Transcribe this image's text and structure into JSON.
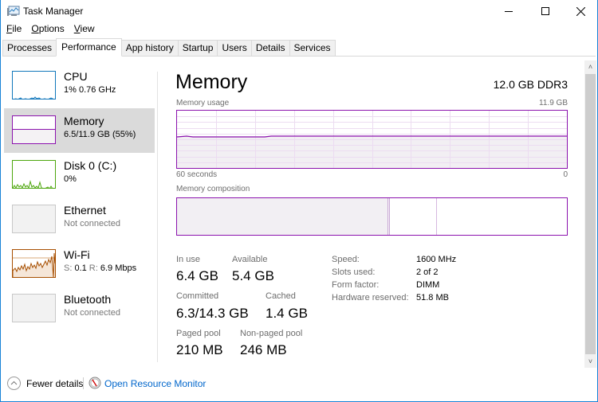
{
  "window": {
    "title": "Task Manager",
    "controls": {
      "minimize": "minimize-icon",
      "maximize": "maximize-icon",
      "close": "close-icon"
    }
  },
  "menu": [
    {
      "label": "File",
      "accel": "F",
      "rest": "ile"
    },
    {
      "label": "Options",
      "accel": "O",
      "rest": "ptions"
    },
    {
      "label": "View",
      "accel": "V",
      "rest": "iew"
    }
  ],
  "tabs": [
    {
      "label": "Processes",
      "active": false
    },
    {
      "label": "Performance",
      "active": true
    },
    {
      "label": "App history",
      "active": false
    },
    {
      "label": "Startup",
      "active": false
    },
    {
      "label": "Users",
      "active": false
    },
    {
      "label": "Details",
      "active": false
    },
    {
      "label": "Services",
      "active": false
    }
  ],
  "sidebar": {
    "items": [
      {
        "name": "CPU",
        "sub": "1%  0.76 GHz",
        "color": "#1177bb",
        "selected": false,
        "muted": false
      },
      {
        "name": "Memory",
        "sub": "6.5/11.9 GB (55%)",
        "color": "#8b12ae",
        "selected": true,
        "muted": false
      },
      {
        "name": "Disk 0 (C:)",
        "sub": "0%",
        "color": "#4da60c",
        "selected": false,
        "muted": false
      },
      {
        "name": "Ethernet",
        "sub": "Not connected",
        "color": "#a0a0a0",
        "selected": false,
        "muted": true
      },
      {
        "name": "Wi-Fi",
        "sub_prefix_s": "S: ",
        "sub_s": "0.1",
        "sub_prefix_r": " R: ",
        "sub_r": "6.9 Mbps",
        "sub": "S: 0.1 R: 6.9 Mbps",
        "color": "#a74f01",
        "selected": false,
        "muted": false
      },
      {
        "name": "Bluetooth",
        "sub": "Not connected",
        "color": "#a0a0a0",
        "selected": false,
        "muted": true
      }
    ]
  },
  "main": {
    "title": "Memory",
    "spec": "12.0 GB DDR3",
    "usage_label": "Memory usage",
    "usage_max": "11.9 GB",
    "time_left": "60 seconds",
    "time_right": "0",
    "usage_fraction": 0.55,
    "composition_label": "Memory composition",
    "composition": {
      "in_use_fraction": 0.54,
      "modified_fraction": 0.006,
      "standby_fraction": 0.12
    },
    "accent": "#8b12ae",
    "stats": {
      "in_use": {
        "label": "In use",
        "value": "6.4 GB"
      },
      "available": {
        "label": "Available",
        "value": "5.4 GB"
      },
      "committed": {
        "label": "Committed",
        "value": "6.3/14.3 GB"
      },
      "cached": {
        "label": "Cached",
        "value": "1.4 GB"
      },
      "paged_pool": {
        "label": "Paged pool",
        "value": "210 MB"
      },
      "nonpaged_pool": {
        "label": "Non-paged pool",
        "value": "246 MB"
      }
    },
    "details": [
      {
        "key": "Speed:",
        "value": "1600 MHz"
      },
      {
        "key": "Slots used:",
        "value": "2 of 2"
      },
      {
        "key": "Form factor:",
        "value": "DIMM"
      },
      {
        "key": "Hardware reserved:",
        "value": "51.8 MB"
      }
    ]
  },
  "footer": {
    "fewer_details": "Fewer details",
    "resource_monitor": "Open Resource Monitor"
  }
}
